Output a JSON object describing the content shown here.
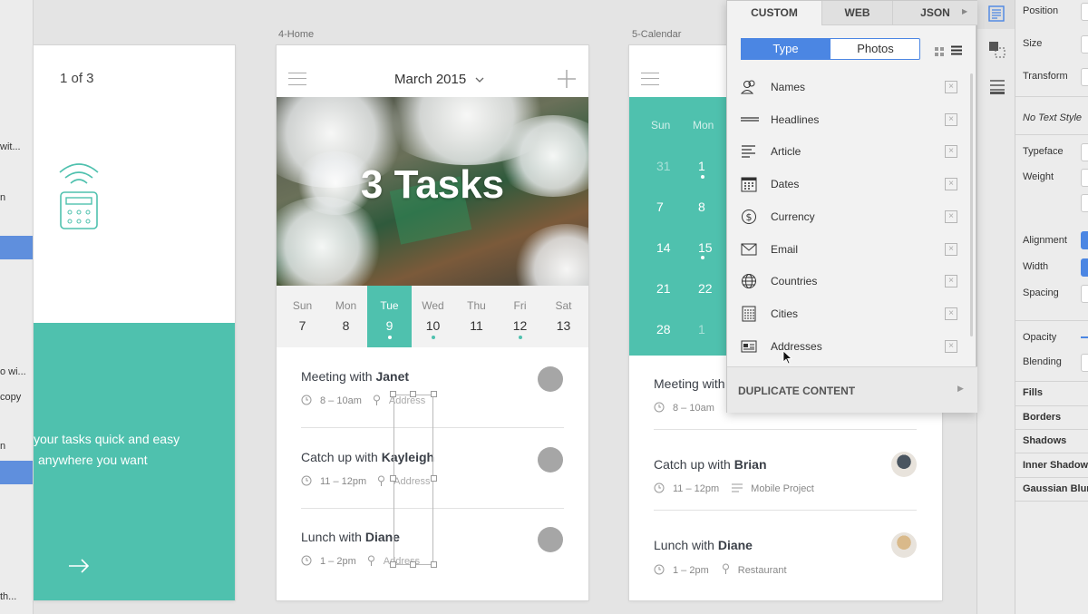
{
  "layers": {
    "rows": [
      {
        "label": "wit...",
        "selected": false
      },
      {
        "label": "n",
        "selected": false
      },
      {
        "label": "",
        "selected": true
      },
      {
        "label": "o wi...",
        "selected": false
      },
      {
        "label": "copy",
        "selected": false
      },
      {
        "label": "n",
        "selected": false
      },
      {
        "label": "",
        "selected": true
      },
      {
        "label": "th...",
        "selected": false
      }
    ]
  },
  "onboarding": {
    "pager": "1 of 3",
    "tagline_1": "your tasks quick and easy",
    "tagline_2": "anywhere you want"
  },
  "home": {
    "artboard_label": "4-Home",
    "month": "March 2015",
    "hero_title": "3 Tasks",
    "days": [
      {
        "name": "Sun",
        "num": "7",
        "active": false,
        "dot": false
      },
      {
        "name": "Mon",
        "num": "8",
        "active": false,
        "dot": false
      },
      {
        "name": "Tue",
        "num": "9",
        "active": true,
        "dot": true
      },
      {
        "name": "Wed",
        "num": "10",
        "active": false,
        "dot": true
      },
      {
        "name": "Thu",
        "num": "11",
        "active": false,
        "dot": false
      },
      {
        "name": "Fri",
        "num": "12",
        "active": false,
        "dot": true
      },
      {
        "name": "Sat",
        "num": "13",
        "active": false,
        "dot": false
      }
    ],
    "tasks": [
      {
        "title": "Meeting with ",
        "person": "Janet",
        "time": "8 – 10am",
        "place": "Address"
      },
      {
        "title": "Catch up with ",
        "person": "Kayleigh",
        "time": "11 – 12pm",
        "place": "Address"
      },
      {
        "title": "Lunch with ",
        "person": "Diane",
        "time": "1 – 2pm",
        "place": "Address"
      }
    ]
  },
  "calendar": {
    "artboard_label": "5-Calendar",
    "weekdays": [
      "Sun",
      "Mon"
    ],
    "rows": [
      [
        "31",
        "1"
      ],
      [
        "7",
        "8"
      ],
      [
        "14",
        "15"
      ],
      [
        "21",
        "22"
      ],
      [
        "28",
        "1"
      ]
    ],
    "tasks": [
      {
        "title": "Meeting with",
        "person": "",
        "time": "8 – 10am",
        "extra": ""
      },
      {
        "title": "Catch up with ",
        "person": "Brian",
        "time": "11 – 12pm",
        "extra": "Mobile Project"
      },
      {
        "title": "Lunch with ",
        "person": "Diane",
        "time": "1 – 2pm",
        "extra": "Restaurant"
      }
    ]
  },
  "content_panel": {
    "tabs": [
      "CUSTOM",
      "WEB",
      "JSON"
    ],
    "active_tab": "CUSTOM",
    "segment": [
      "Type",
      "Photos"
    ],
    "active_segment": "Type",
    "items": [
      {
        "label": "Names",
        "icon": "people-icon"
      },
      {
        "label": "Headlines",
        "icon": "headline-icon"
      },
      {
        "label": "Article",
        "icon": "article-icon"
      },
      {
        "label": "Dates",
        "icon": "calendar-icon"
      },
      {
        "label": "Currency",
        "icon": "dollar-icon"
      },
      {
        "label": "Email",
        "icon": "envelope-icon"
      },
      {
        "label": "Countries",
        "icon": "globe-icon"
      },
      {
        "label": "Cities",
        "icon": "building-icon"
      },
      {
        "label": "Addresses",
        "icon": "address-card-icon"
      }
    ],
    "duplicate_label": "DUPLICATE CONTENT",
    "accent": "#4b86e3"
  },
  "inspector": {
    "position": "Position",
    "size": "Size",
    "transform": "Transform",
    "text_style": "No Text Style",
    "typeface": "Typeface",
    "weight": "Weight",
    "alignment": "Alignment",
    "width": "Width",
    "spacing": "Spacing",
    "opacity": "Opacity",
    "blending": "Blending",
    "fills": "Fills",
    "borders": "Borders",
    "shadows": "Shadows",
    "inner_shadows": "Inner Shadows",
    "gaussian_blur": "Gaussian Blur"
  },
  "colors": {
    "teal": "#4fc1ae",
    "accent_blue": "#4b86e3"
  }
}
